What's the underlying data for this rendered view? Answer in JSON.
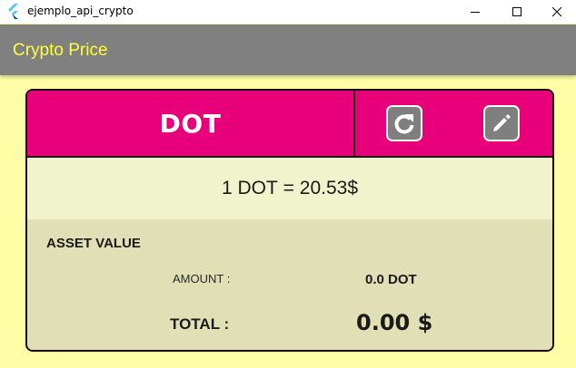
{
  "window": {
    "title": "ejemplo_api_crypto"
  },
  "appbar": {
    "title": "Crypto Price"
  },
  "card": {
    "symbol": "DOT",
    "price": {
      "amount_prefix": "1 DOT",
      "equals": " = ",
      "value": "20.53$"
    },
    "asset": {
      "heading": "ASSET VALUE",
      "amount_label": "AMOUNT :",
      "amount_value": "0.0 DOT",
      "total_label": "TOTAL :",
      "total_value": "0.00 $"
    }
  },
  "icons": {
    "refresh": "refresh-icon",
    "edit": "pencil-icon",
    "app": "flutter-logo-icon"
  },
  "colors": {
    "header_pink": "#e8007a",
    "appbar_gray": "#808080",
    "appbar_title": "#ffff3a",
    "background": "#fffda6",
    "price_row": "#f1f3cc",
    "asset_section": "#e0dfb6",
    "icon_button": "#7f7f7f"
  }
}
